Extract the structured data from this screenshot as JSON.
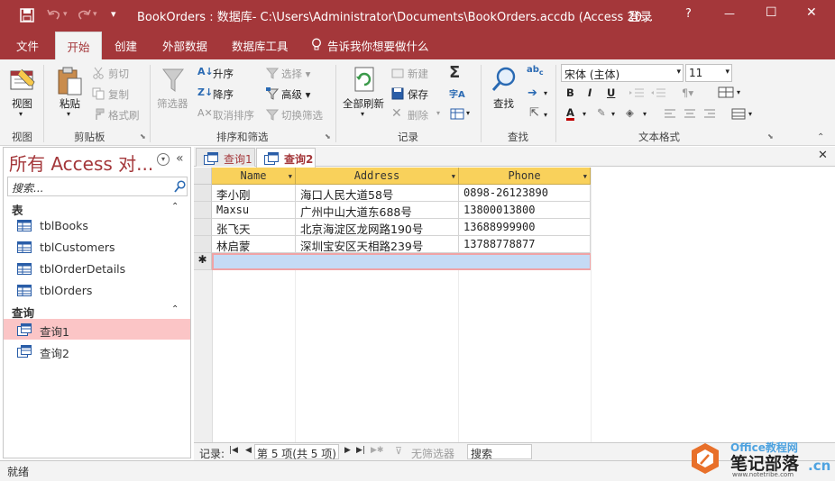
{
  "titlebar": {
    "title": "BookOrders : 数据库- C:\\Users\\Administrator\\Documents\\BookOrders.accdb (Access 20...",
    "login_label": "登录",
    "help_symbol": "?",
    "minimize_symbol": "—",
    "maximize_symbol": "☐",
    "close_symbol": "✕",
    "qat_more_symbol": "▾"
  },
  "ribbon_tabs": {
    "file": "文件",
    "home": "开始",
    "create": "创建",
    "external_data": "外部数据",
    "db_tools": "数据库工具",
    "tell_me": "告诉我你想要做什么"
  },
  "ribbon": {
    "view": {
      "button": "视图",
      "group": "视图"
    },
    "clipboard": {
      "paste": "粘贴",
      "cut": "剪切",
      "copy": "复制",
      "format_painter": "格式刷",
      "group": "剪贴板"
    },
    "sort_filter": {
      "filter": "筛选器",
      "ascending": "升序",
      "descending": "降序",
      "remove_sort": "取消排序",
      "selection": "选择",
      "advanced": "高级",
      "toggle_filter": "切换筛选",
      "group": "排序和筛选"
    },
    "records": {
      "refresh_all": "全部刷新",
      "new": "新建",
      "save": "保存",
      "delete": "删除",
      "group": "记录"
    },
    "find": {
      "find": "查找",
      "group": "查找"
    },
    "text_format": {
      "font_name": "宋体 (主体)",
      "font_size": "11",
      "bold": "B",
      "italic": "I",
      "underline": "U",
      "group": "文本格式"
    }
  },
  "nav": {
    "title": "所有 Access 对...",
    "search_placeholder": "搜索...",
    "sections": [
      {
        "label": "表",
        "items": [
          "tblBooks",
          "tblCustomers",
          "tblOrderDetails",
          "tblOrders"
        ]
      },
      {
        "label": "查询",
        "items": [
          "查询1",
          "查询2"
        ]
      }
    ],
    "collapse_symbol": "«",
    "section_collapse_symbol": "⌃"
  },
  "doc_tabs": [
    {
      "label": "查询1",
      "active": false
    },
    {
      "label": "查询2",
      "active": true
    }
  ],
  "doc_close_symbol": "✕",
  "grid": {
    "columns": [
      "Name",
      "Address",
      "Phone"
    ],
    "rows": [
      [
        "李小刚",
        "海口人民大道58号",
        "0898-26123890"
      ],
      [
        "Maxsu",
        "广州中山大道东688号",
        "13800013800"
      ],
      [
        "张飞天",
        "北京海淀区龙网路190号",
        "13688999900"
      ],
      [
        "林启蒙",
        "深圳宝安区天相路239号",
        "13788778877"
      ]
    ],
    "new_row_symbol": "✱"
  },
  "record_nav": {
    "label": "记录:",
    "position": "第 5 项(共 5 项)",
    "filter_label": "无筛选器",
    "search_label": "搜索"
  },
  "status": {
    "text": "就绪"
  },
  "watermark": {
    "text": "笔记部落",
    "sub": "www.notetribe.com",
    "extra": "Office教程网",
    "domain": ".cn"
  },
  "colors": {
    "accent": "#a4373a",
    "header": "#f9d15b",
    "selection": "#fbc5c6",
    "new_row": "#c5dbf5"
  }
}
